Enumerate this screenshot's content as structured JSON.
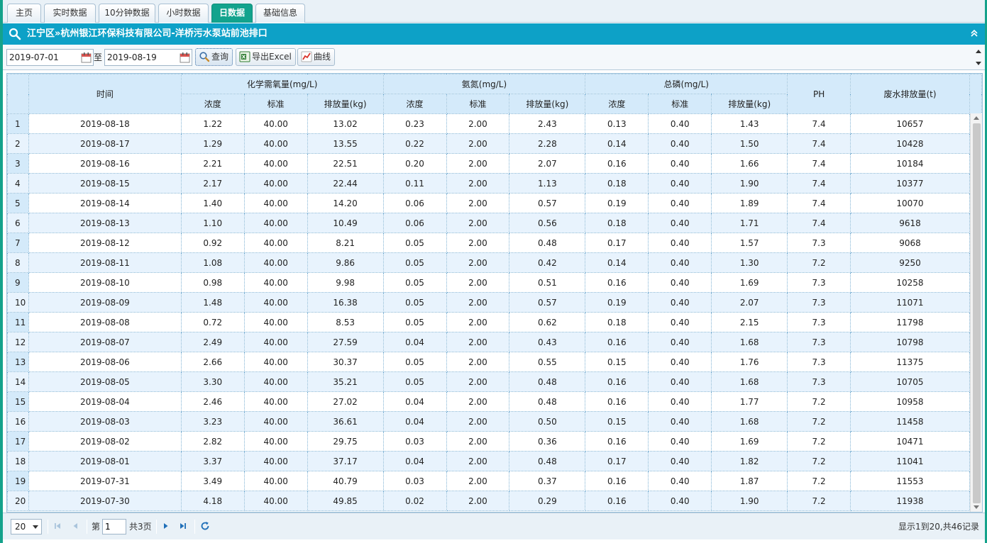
{
  "tabs": [
    {
      "label": "主页",
      "active": false
    },
    {
      "label": "实时数据",
      "active": false
    },
    {
      "label": "10分钟数据",
      "active": false
    },
    {
      "label": "小时数据",
      "active": false
    },
    {
      "label": "日数据",
      "active": true
    },
    {
      "label": "基础信息",
      "active": false
    }
  ],
  "panel": {
    "title": "江宁区»杭州银江环保科技有限公司-洋桥污水泵站前池排口"
  },
  "toolbar": {
    "start_date": "2019-07-01",
    "to_label": "至",
    "end_date": "2019-08-19",
    "query_label": "查询",
    "export_label": "导出Excel",
    "curve_label": "曲线"
  },
  "table": {
    "header_time": "时间",
    "groups": [
      {
        "label": "化学需氧量(mg/L)"
      },
      {
        "label": "氨氮(mg/L)"
      },
      {
        "label": "总磷(mg/L)"
      }
    ],
    "sub_headers": [
      "浓度",
      "标准",
      "排放量(kg)"
    ],
    "header_ph": "PH",
    "header_water": "废水排放量(t)",
    "rows": [
      [
        "2019-08-18",
        "1.22",
        "40.00",
        "13.02",
        "0.23",
        "2.00",
        "2.43",
        "0.13",
        "0.40",
        "1.43",
        "7.4",
        "10657"
      ],
      [
        "2019-08-17",
        "1.29",
        "40.00",
        "13.55",
        "0.22",
        "2.00",
        "2.28",
        "0.14",
        "0.40",
        "1.50",
        "7.4",
        "10428"
      ],
      [
        "2019-08-16",
        "2.21",
        "40.00",
        "22.51",
        "0.20",
        "2.00",
        "2.07",
        "0.16",
        "0.40",
        "1.66",
        "7.4",
        "10184"
      ],
      [
        "2019-08-15",
        "2.17",
        "40.00",
        "22.44",
        "0.11",
        "2.00",
        "1.13",
        "0.18",
        "0.40",
        "1.90",
        "7.4",
        "10377"
      ],
      [
        "2019-08-14",
        "1.40",
        "40.00",
        "14.20",
        "0.06",
        "2.00",
        "0.57",
        "0.19",
        "0.40",
        "1.89",
        "7.4",
        "10070"
      ],
      [
        "2019-08-13",
        "1.10",
        "40.00",
        "10.49",
        "0.06",
        "2.00",
        "0.56",
        "0.18",
        "0.40",
        "1.71",
        "7.4",
        "9618"
      ],
      [
        "2019-08-12",
        "0.92",
        "40.00",
        "8.21",
        "0.05",
        "2.00",
        "0.48",
        "0.17",
        "0.40",
        "1.57",
        "7.3",
        "9068"
      ],
      [
        "2019-08-11",
        "1.08",
        "40.00",
        "9.86",
        "0.05",
        "2.00",
        "0.42",
        "0.14",
        "0.40",
        "1.30",
        "7.2",
        "9250"
      ],
      [
        "2019-08-10",
        "0.98",
        "40.00",
        "9.98",
        "0.05",
        "2.00",
        "0.51",
        "0.16",
        "0.40",
        "1.69",
        "7.3",
        "10258"
      ],
      [
        "2019-08-09",
        "1.48",
        "40.00",
        "16.38",
        "0.05",
        "2.00",
        "0.57",
        "0.19",
        "0.40",
        "2.07",
        "7.3",
        "11071"
      ],
      [
        "2019-08-08",
        "0.72",
        "40.00",
        "8.53",
        "0.05",
        "2.00",
        "0.62",
        "0.18",
        "0.40",
        "2.15",
        "7.3",
        "11798"
      ],
      [
        "2019-08-07",
        "2.49",
        "40.00",
        "27.59",
        "0.04",
        "2.00",
        "0.43",
        "0.16",
        "0.40",
        "1.68",
        "7.3",
        "10798"
      ],
      [
        "2019-08-06",
        "2.66",
        "40.00",
        "30.37",
        "0.05",
        "2.00",
        "0.55",
        "0.15",
        "0.40",
        "1.76",
        "7.3",
        "11375"
      ],
      [
        "2019-08-05",
        "3.30",
        "40.00",
        "35.21",
        "0.05",
        "2.00",
        "0.48",
        "0.16",
        "0.40",
        "1.68",
        "7.3",
        "10705"
      ],
      [
        "2019-08-04",
        "2.46",
        "40.00",
        "27.02",
        "0.04",
        "2.00",
        "0.48",
        "0.16",
        "0.40",
        "1.77",
        "7.2",
        "10958"
      ],
      [
        "2019-08-03",
        "3.23",
        "40.00",
        "36.61",
        "0.04",
        "2.00",
        "0.50",
        "0.15",
        "0.40",
        "1.68",
        "7.2",
        "11458"
      ],
      [
        "2019-08-02",
        "2.82",
        "40.00",
        "29.75",
        "0.03",
        "2.00",
        "0.36",
        "0.16",
        "0.40",
        "1.69",
        "7.2",
        "10471"
      ],
      [
        "2019-08-01",
        "3.37",
        "40.00",
        "37.17",
        "0.04",
        "2.00",
        "0.48",
        "0.17",
        "0.40",
        "1.82",
        "7.2",
        "11041"
      ],
      [
        "2019-07-31",
        "3.49",
        "40.00",
        "40.79",
        "0.03",
        "2.00",
        "0.37",
        "0.16",
        "0.40",
        "1.87",
        "7.2",
        "11553"
      ],
      [
        "2019-07-30",
        "4.18",
        "40.00",
        "49.85",
        "0.02",
        "2.00",
        "0.29",
        "0.16",
        "0.40",
        "1.90",
        "7.2",
        "11938"
      ]
    ]
  },
  "pager": {
    "page_size": "20",
    "page_prefix": "第",
    "current_page": "1",
    "total_pages_label": "共3页",
    "summary": "显示1到20,共46记录"
  },
  "colors": {
    "accent_green": "#12a38d",
    "title_blue": "#0da1c7",
    "header_bg": "#d4eafa",
    "alt_row_bg": "#e8f3fd"
  }
}
